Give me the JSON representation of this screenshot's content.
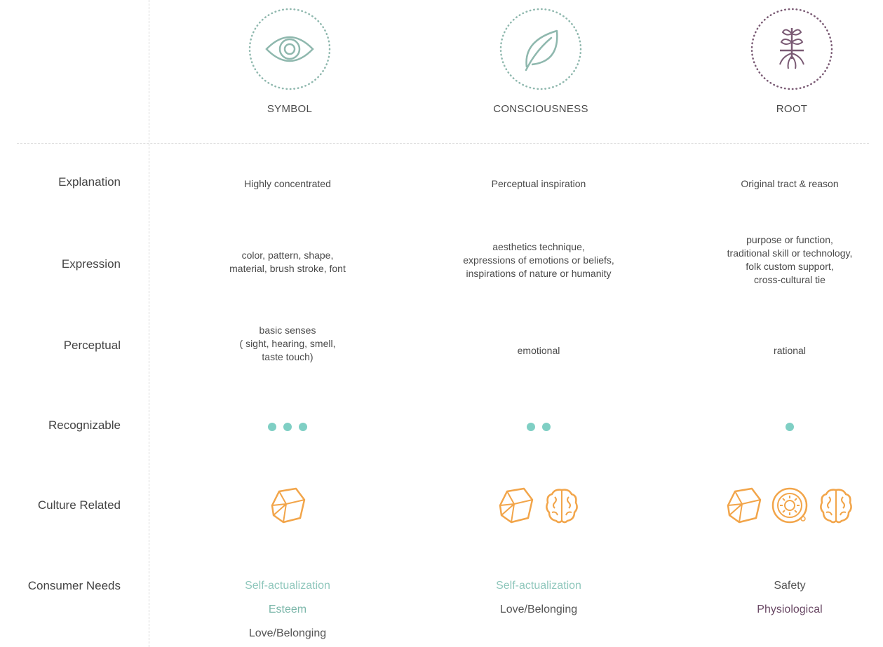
{
  "columns": [
    {
      "title": "SYMBOL",
      "icon": "eye-icon"
    },
    {
      "title": "CONSCIOUSNESS",
      "icon": "leaf-icon"
    },
    {
      "title": "ROOT",
      "icon": "sprout-roots-icon"
    }
  ],
  "row_labels": {
    "explanation": "Explanation",
    "expression": "Expression",
    "perceptual": "Perceptual",
    "recognizable": "Recognizable",
    "culture_related": "Culture Related",
    "consumer_needs": "Consumer Needs"
  },
  "explanation": [
    "Highly concentrated",
    "Perceptual inspiration",
    "Original tract & reason"
  ],
  "expression": [
    [
      "color, pattern, shape,",
      "material, brush stroke, font"
    ],
    [
      "aesthetics technique,",
      "expressions of emotions or beliefs,",
      "inspirations of nature or humanity"
    ],
    [
      "purpose or function,",
      "traditional skill or technology,",
      "folk custom support,",
      "cross-cultural tie"
    ]
  ],
  "perceptual": [
    [
      "basic senses",
      "( sight, hearing, smell,",
      "taste touch)"
    ],
    [
      "emotional"
    ],
    [
      "rational"
    ]
  ],
  "recognizable_dots": [
    3,
    2,
    1
  ],
  "culture_icons": [
    [
      "stone-icon"
    ],
    [
      "stone-icon",
      "brain-icon"
    ],
    [
      "stone-icon",
      "sun-circle-icon",
      "brain-icon"
    ]
  ],
  "consumer_needs": [
    [
      {
        "text": "Self-actualization",
        "color": "#8fc7bc"
      },
      {
        "text": "Esteem",
        "color": "#7cb7aa"
      },
      {
        "text": "Love/Belonging",
        "color": "#555555"
      }
    ],
    [
      {
        "text": "Self-actualization",
        "color": "#8fc7bc"
      },
      {
        "text": "Love/Belonging",
        "color": "#555555"
      }
    ],
    [
      {
        "text": "Safety",
        "color": "#555555"
      },
      {
        "text": "Physiological",
        "color": "#6b4a66"
      }
    ]
  ],
  "colors": {
    "teal": "#7fcfc4",
    "orange": "#f2a54a",
    "ring_teal": "#8fb8ae",
    "ring_plum": "#7a5a74"
  }
}
